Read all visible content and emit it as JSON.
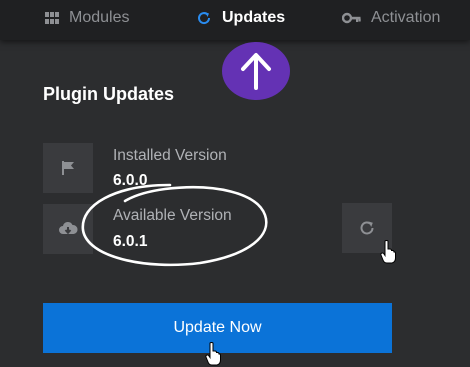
{
  "nav": {
    "modules": {
      "label": "Modules",
      "icon": "grid-icon"
    },
    "updates": {
      "label": "Updates",
      "icon": "refresh-icon",
      "active": true
    },
    "activation": {
      "label": "Activation",
      "icon": "key-icon"
    }
  },
  "colors": {
    "accent_blue": "#0b73d8",
    "arrow_purple": "#6432b4",
    "background": "#2c2d2f",
    "nav_background": "#1f2022"
  },
  "section": {
    "title": "Plugin Updates"
  },
  "versions": {
    "installed": {
      "label": "Installed Version",
      "value": "6.0.0"
    },
    "available": {
      "label": "Available Version",
      "value": "6.0.1"
    }
  },
  "icons": {
    "installed": "flag-icon",
    "available": "cloud-download-icon",
    "check": "refresh-icon"
  },
  "actions": {
    "update_label": "Update Now"
  }
}
